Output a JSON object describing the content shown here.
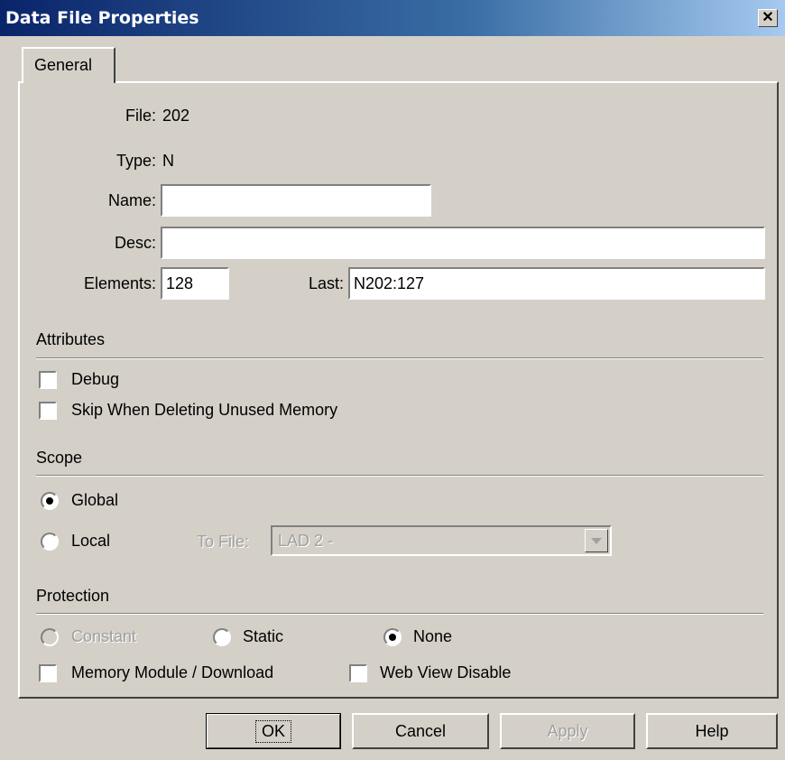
{
  "window": {
    "title": "Data File Properties",
    "close": "✕"
  },
  "tab": {
    "label": "General"
  },
  "general": {
    "file_label": "File:",
    "file_value": "202",
    "type_label": "Type:",
    "type_value": "N",
    "name_label": "Name:",
    "name_value": "",
    "desc_label": "Desc:",
    "desc_value": "",
    "elements_label": "Elements:",
    "elements_value": "128",
    "last_label": "Last:",
    "last_value": "N202:127"
  },
  "attributes": {
    "heading": "Attributes",
    "debug_label": "Debug",
    "debug_checked": false,
    "skip_label": "Skip When Deleting Unused Memory",
    "skip_checked": false
  },
  "scope": {
    "heading": "Scope",
    "global_label": "Global",
    "global_selected": true,
    "local_label": "Local",
    "local_selected": false,
    "to_file_label": "To File:",
    "to_file_value": "LAD 2 -"
  },
  "protection": {
    "heading": "Protection",
    "constant_label": "Constant",
    "static_label": "Static",
    "none_label": "None",
    "selected": "None",
    "memory_module_label": "Memory Module / Download",
    "web_view_label": "Web View Disable"
  },
  "buttons": {
    "ok": "OK",
    "cancel": "Cancel",
    "apply": "Apply",
    "help": "Help"
  }
}
